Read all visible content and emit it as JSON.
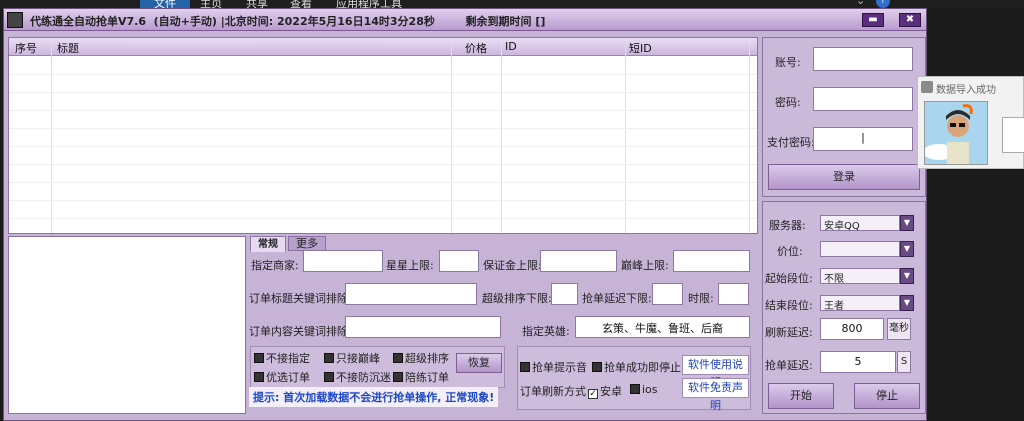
{
  "ribbon": {
    "tabs": [
      "文件",
      "主页",
      "共享",
      "查看",
      "应用程序工具"
    ]
  },
  "window": {
    "title": "代练通全自动抢单V7.6  (自动+手动) |北京时间: 2022年5月16日14时3分28秒        剩余到期时间 []",
    "minimize": "▬",
    "close": "✖"
  },
  "table": {
    "columns": [
      "序号",
      "标题",
      "价格",
      "ID",
      "短ID"
    ]
  },
  "tabs": [
    "常规",
    "更多"
  ],
  "filters": {
    "merchant_label": "指定商家:",
    "star_label": "星星上限:",
    "deposit_label": "保证金上限:",
    "peak_label": "巅峰上限:",
    "title_exclude_label": "订单标题关键词排除:",
    "super_sort_label": "超级排序下限:",
    "delay_lower_label": "抢单延迟下限:",
    "time_limit_label": "时限:",
    "content_exclude_label": "订单内容关键词排除:",
    "hero_label": "指定英雄:",
    "hero_value": "玄策、牛魔、鲁班、后裔"
  },
  "checks": {
    "no_specify": "不接指定",
    "only_peak": "只接巅峰",
    "super_sort": "超级排序",
    "restore": "恢复",
    "preferred": "优选订单",
    "no_addiction": "不接防沉迷",
    "accompany": "陪练订单",
    "sound": "抢单提示音",
    "stop_on_success": "抢单成功即停止",
    "manual_btn": "软件使用说明",
    "disclaimer_btn": "软件免责声明",
    "refresh_mode_label": "订单刷新方式",
    "android": "安卓",
    "ios": "ios"
  },
  "tip": "提示: 首次加载数据不会进行抢单操作, 正常现象!",
  "account": {
    "account_label": "账号:",
    "password_label": "密码:",
    "pay_password_label": "支付密码:",
    "pay_password_value": "|",
    "login": "登录"
  },
  "settings": {
    "server_label": "服务器:",
    "server_value": "安卓QQ",
    "price_label": "价位:",
    "price_value": "",
    "start_rank_label": "起始段位:",
    "start_rank_value": "不限",
    "end_rank_label": "结束段位:",
    "end_rank_value": "王者",
    "refresh_delay_label": "刷新延迟:",
    "refresh_delay_value": "800",
    "refresh_unit": "毫秒",
    "grab_delay_label": "抢单延迟:",
    "grab_delay_value": "5",
    "grab_unit": "S",
    "start": "开始",
    "stop": "停止"
  },
  "popup": {
    "title": "数据导入成功"
  },
  "colors": {
    "accent": "#6a4a82",
    "panel": "#c6b3d6",
    "tip": "#1c47c9"
  }
}
